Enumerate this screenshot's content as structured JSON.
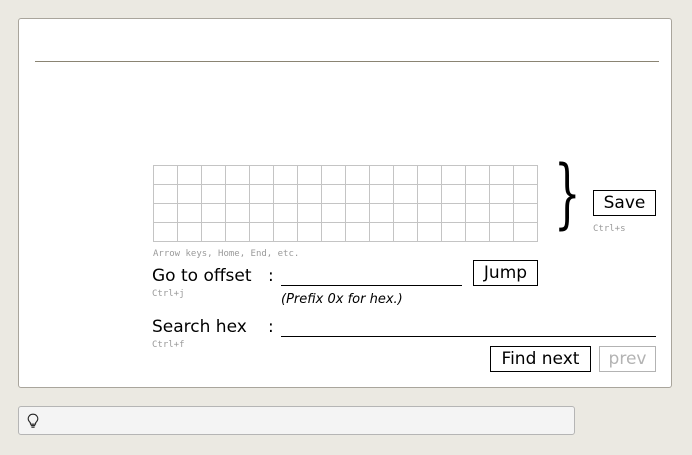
{
  "hex_view": {
    "rows": 4,
    "cols": 16,
    "hint": "Arrow keys, Home, End, etc."
  },
  "save": {
    "label": "Save",
    "shortcut": "Ctrl+s"
  },
  "goto": {
    "label": "Go to offset",
    "colon": ":",
    "value": "",
    "button": "Jump",
    "shortcut": "Ctrl+j",
    "note": "(Prefix 0x for hex.)"
  },
  "search": {
    "label": "Search hex",
    "colon": ":",
    "value": "",
    "shortcut": "Ctrl+f",
    "find_next": "Find next",
    "prev": "prev"
  },
  "statusbar": {
    "icon": "lightbulb-icon",
    "text": ""
  }
}
